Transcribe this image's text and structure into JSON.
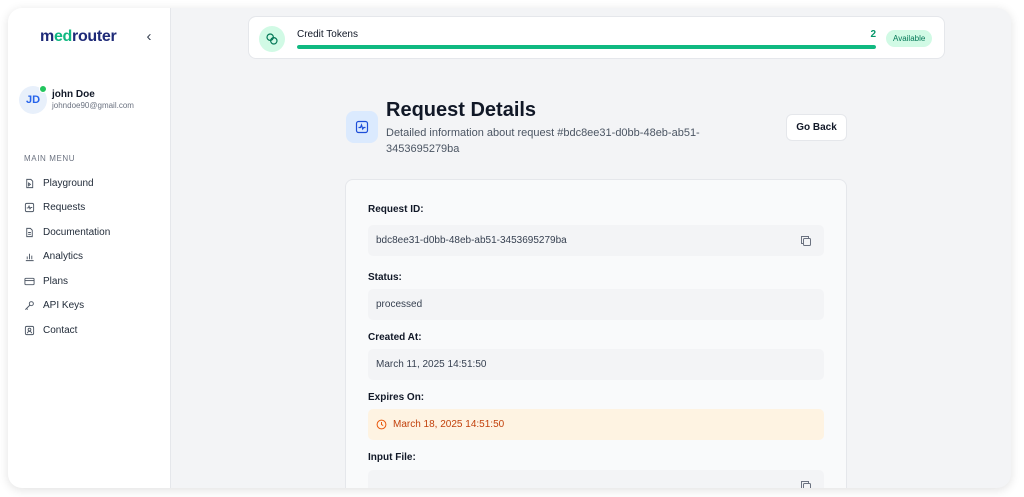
{
  "app": {
    "logo_prefix": "m",
    "logo_accent": "ed",
    "logo_suffix": "router",
    "collapse_icon": "chevron-left-icon"
  },
  "user": {
    "initials": "JD",
    "name": "john Doe",
    "email": "johndoe90@gmail.com",
    "status_color": "#22c55e"
  },
  "sidebar": {
    "section_title": "MAIN MENU",
    "items": [
      {
        "label": "Playground",
        "icon": "playground-icon"
      },
      {
        "label": "Requests",
        "icon": "requests-icon"
      },
      {
        "label": "Documentation",
        "icon": "document-icon"
      },
      {
        "label": "Analytics",
        "icon": "bar-chart-icon"
      },
      {
        "label": "Plans",
        "icon": "credit-card-icon"
      },
      {
        "label": "API Keys",
        "icon": "key-icon"
      },
      {
        "label": "Contact",
        "icon": "contact-icon"
      }
    ]
  },
  "credits": {
    "title": "Credit Tokens",
    "count": "2",
    "progress": 1.0,
    "badge": "Available",
    "accent": "#10b981"
  },
  "header": {
    "title": "Request Details",
    "subtitle": "Detailed information about request #bdc8ee31-d0bb-48eb-ab51-3453695279ba",
    "back_label": "Go Back"
  },
  "details": {
    "request_id_label": "Request ID:",
    "request_id": "bdc8ee31-d0bb-48eb-ab51-3453695279ba",
    "status_label": "Status:",
    "status": "processed",
    "created_label": "Created At:",
    "created": "March 11, 2025 14:51:50",
    "expires_label": "Expires On:",
    "expires": "March 18, 2025 14:51:50",
    "input_file_label": "Input File:"
  }
}
